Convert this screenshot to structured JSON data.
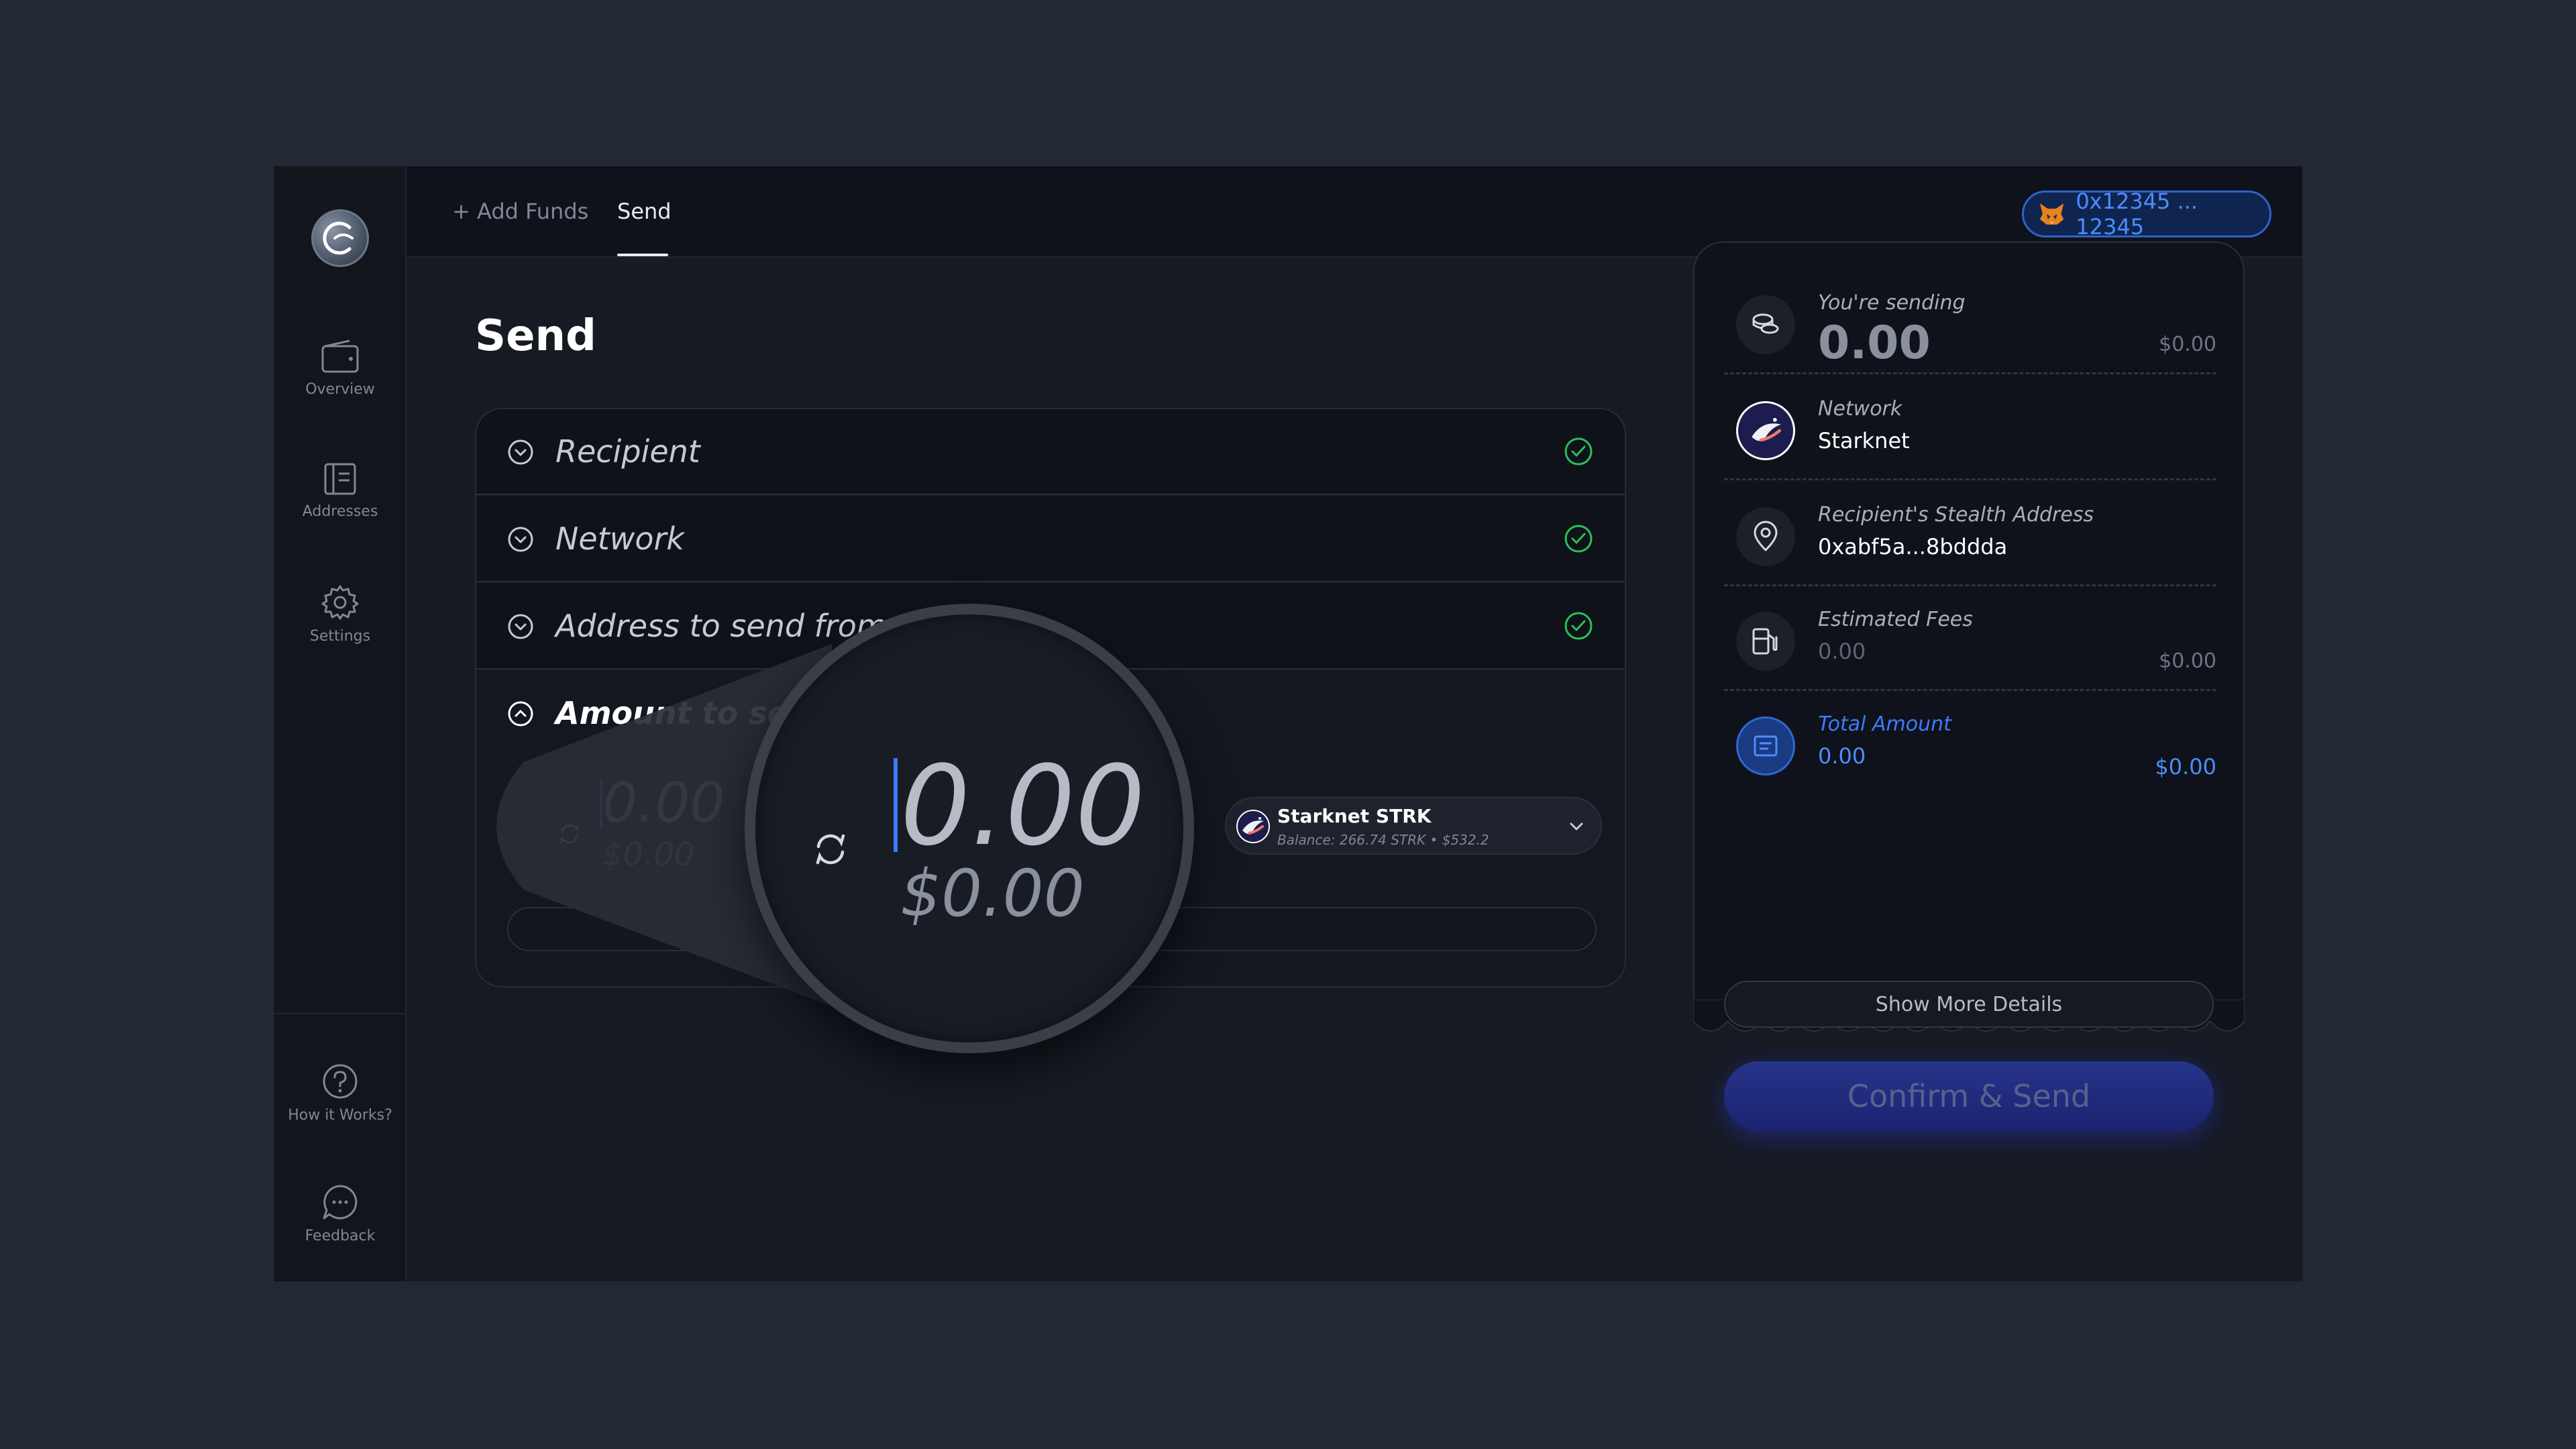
{
  "sidebar": {
    "items": [
      {
        "label": "Overview",
        "icon": "wallet-icon"
      },
      {
        "label": "Addresses",
        "icon": "address-book-icon"
      },
      {
        "label": "Settings",
        "icon": "gear-icon"
      }
    ],
    "footer": [
      {
        "label": "How it Works?",
        "icon": "help-icon"
      },
      {
        "label": "Feedback",
        "icon": "chat-icon"
      }
    ]
  },
  "topbar": {
    "tabs": [
      {
        "label": "+ Add Funds"
      },
      {
        "label": "Send"
      }
    ],
    "wallet_address": "0x12345 ... 12345"
  },
  "page": {
    "title": "Send"
  },
  "form": {
    "sections": [
      {
        "label": "Recipient"
      },
      {
        "label": "Network"
      },
      {
        "label": "Address to send from"
      },
      {
        "label": "Amount to send"
      }
    ],
    "amount": {
      "value": "0.00",
      "usd": "$0.00"
    },
    "token": {
      "name": "Starknet STRK",
      "balance": "Balance: 266.74 STRK  •  $532.2"
    }
  },
  "summary": {
    "sending_label": "You're sending",
    "sending_value": "0.00",
    "sending_usd": "$0.00",
    "network_label": "Network",
    "network_value": "Starknet",
    "recipient_label": "Recipient's Stealth Address",
    "recipient_value": "0xabf5a...8bddda",
    "fees_label": "Estimated Fees",
    "fees_value": "0.00",
    "fees_usd": "$0.00",
    "total_label": "Total Amount",
    "total_value": "0.00",
    "total_usd": "$0.00",
    "more_label": "Show More Details",
    "confirm_label": "Confirm & Send"
  },
  "colors": {
    "accent": "#3c7bff",
    "success": "#2bbf5a",
    "background": "#222834"
  }
}
